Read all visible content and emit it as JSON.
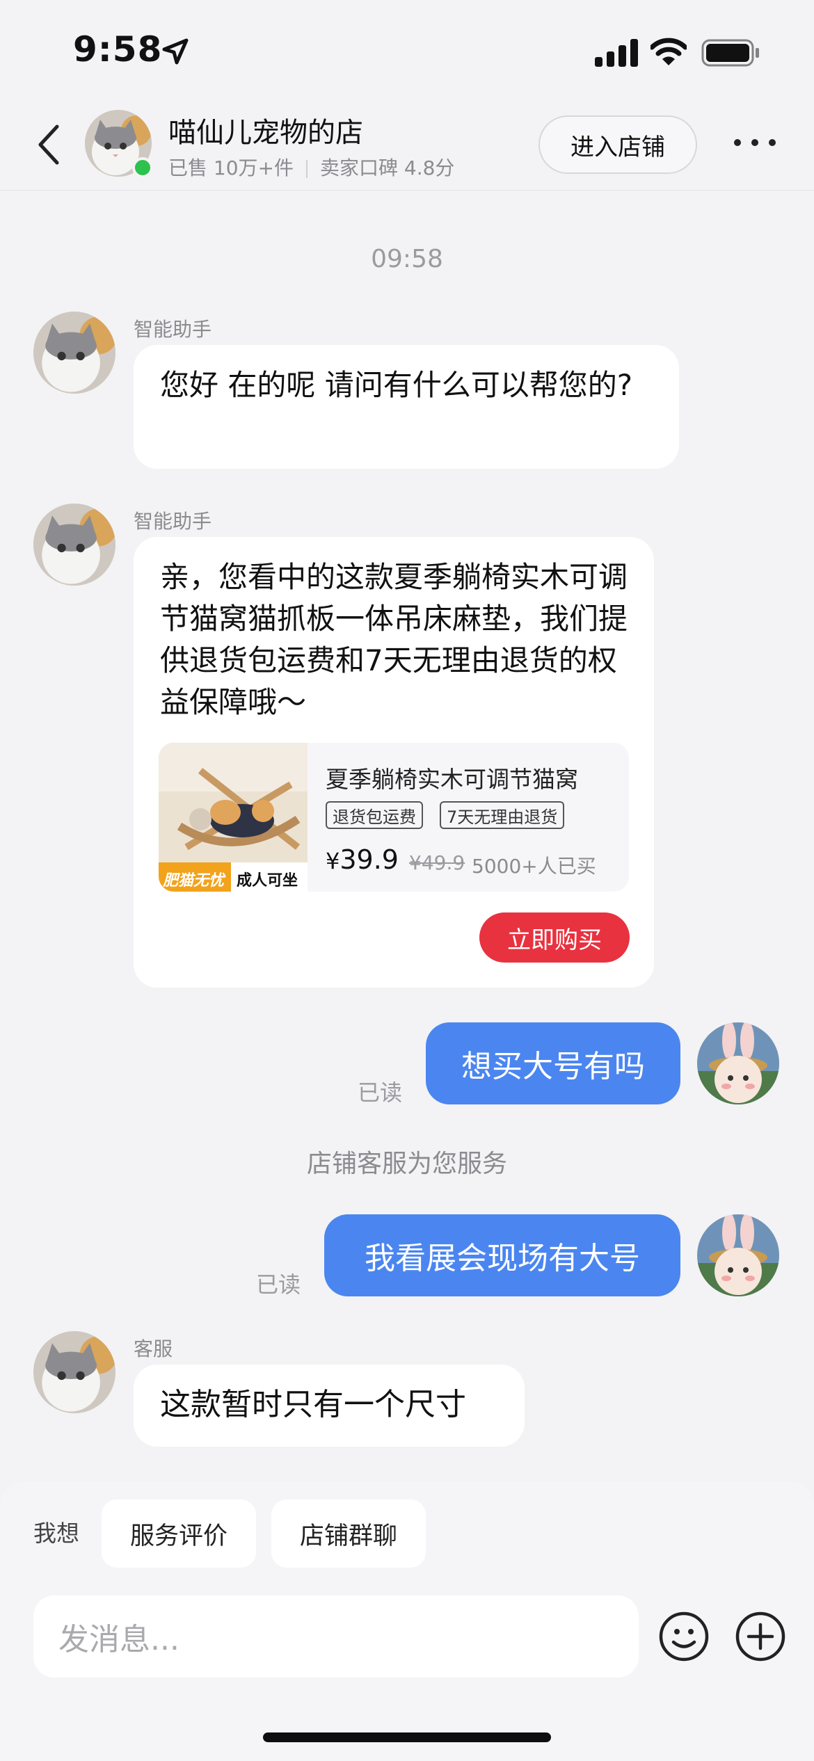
{
  "status_bar": {
    "time": "9:58"
  },
  "header": {
    "shop_name": "喵仙儿宠物的店",
    "sold": "已售 10万+件",
    "rating": "卖家口碑 4.8分",
    "enter_label": "进入店铺"
  },
  "chat": {
    "timestamp": "09:58",
    "messages": [
      {
        "sender": "智能助手",
        "text": "您好 在的呢 请问有什么可以帮您的?"
      },
      {
        "sender": "智能助手",
        "text": "亲，您看中的这款夏季躺椅实木可调节猫窝猫抓板一体吊床麻垫，我们提供退货包运费和7天无理由退货的权益保障哦～"
      },
      {
        "text": "想买大号有吗",
        "read": "已读"
      },
      {
        "text": "我看展会现场有大号",
        "read": "已读"
      },
      {
        "sender": "客服",
        "text": "这款暂时只有一个尺寸"
      }
    ],
    "system_note": "店铺客服为您服务"
  },
  "product": {
    "title": "夏季躺椅实木可调节猫窝",
    "tags": [
      "退货包运费",
      "7天无理由退货"
    ],
    "currency": "¥",
    "price": "39.9",
    "original_price": "¥49.9",
    "sold_count": "5000+人已买",
    "buy_label": "立即购买",
    "image_badge_left": "肥猫无忧",
    "image_badge_right": "成人可坐"
  },
  "bottom": {
    "wish_label": "我想",
    "chips": [
      "服务评价",
      "店铺群聊"
    ],
    "input_placeholder": "发消息..."
  },
  "colors": {
    "accent_blue": "#4b86f0",
    "buy_red": "#e8323f",
    "online_green": "#2dc14e"
  }
}
